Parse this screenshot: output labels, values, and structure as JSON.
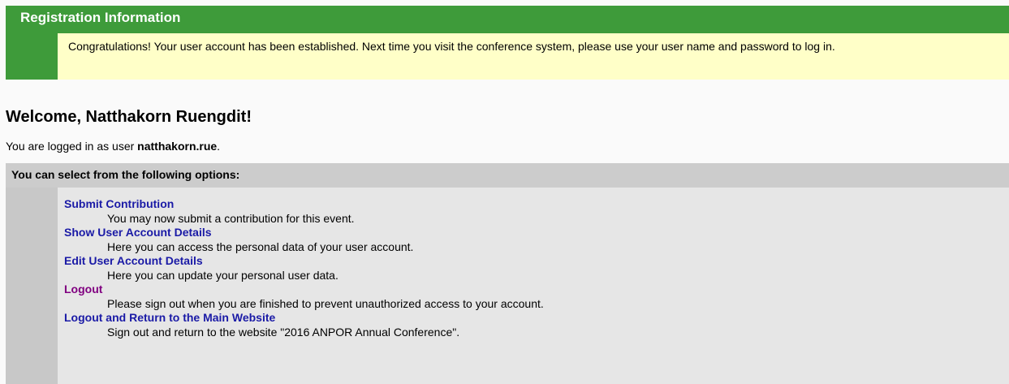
{
  "registration": {
    "title": "Registration Information",
    "message": "Congratulations! Your user account has been established. Next time you visit the conference system, please use your user name and password to log in."
  },
  "welcome": {
    "heading": "Welcome, Natthakorn Ruengdit!",
    "logged_in_prefix": "You are logged in as user ",
    "username": "natthakorn.rue",
    "logged_in_suffix": "."
  },
  "options": {
    "header": "You can select from the following options:",
    "items": [
      {
        "label": "Submit Contribution",
        "description": "You may now submit a contribution for this event."
      },
      {
        "label": "Show User Account Details",
        "description": "Here you can access the personal data of your user account."
      },
      {
        "label": "Edit User Account Details",
        "description": "Here you can update your personal user data."
      },
      {
        "label": "Logout",
        "description": "Please sign out when you are finished to prevent unauthorized access to your account."
      },
      {
        "label": "Logout and Return to the Main Website",
        "description": "Sign out and return to the website \"2016 ANPOR Annual Conference\"."
      }
    ]
  },
  "colors": {
    "header_green": "#3e9b3a",
    "message_yellow": "#ffffc8",
    "link_blue": "#1a1aa6",
    "link_visited": "#800080"
  }
}
